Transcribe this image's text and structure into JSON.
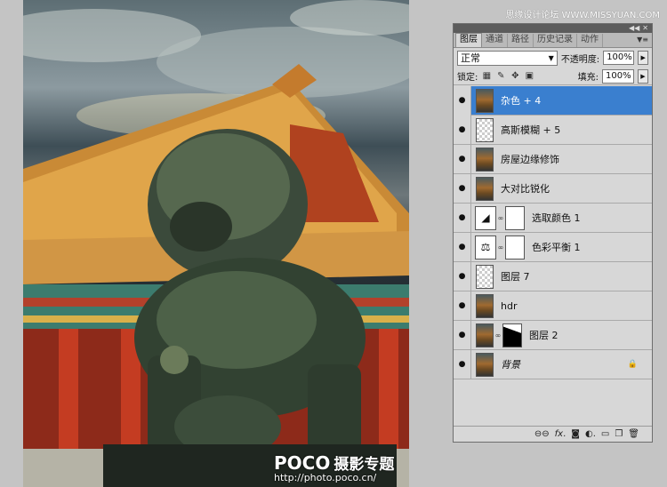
{
  "watermark": "思缘设计论坛 WWW.MISSYUAN.COM",
  "photo": {
    "brand": "POCO",
    "brand_sub": "摄影专题",
    "url": "http://photo.poco.cn/"
  },
  "panel": {
    "tabs": [
      {
        "label": "图层",
        "active": true
      },
      {
        "label": "通道",
        "active": false
      },
      {
        "label": "路径",
        "active": false
      },
      {
        "label": "历史记录",
        "active": false
      },
      {
        "label": "动作",
        "active": false
      }
    ],
    "blend_mode": "正常",
    "opacity_label": "不透明度:",
    "opacity_value": "100%",
    "lock_label": "锁定:",
    "fill_label": "填充:",
    "fill_value": "100%",
    "layers": [
      {
        "name": "杂色 + 4",
        "thumb": "photo",
        "selected": true
      },
      {
        "name": "高斯模糊 + 5",
        "thumb": "transparent",
        "selected": false
      },
      {
        "name": "房屋边缘修饰",
        "thumb": "photo",
        "selected": false
      },
      {
        "name": "大对比锐化",
        "thumb": "photo",
        "selected": false
      },
      {
        "name": "选取颜色 1",
        "thumb": "adjust-selective",
        "mask": "white",
        "selected": false
      },
      {
        "name": "色彩平衡 1",
        "thumb": "adjust-balance",
        "mask": "white",
        "selected": false
      },
      {
        "name": "图层 7",
        "thumb": "transparent",
        "selected": false
      },
      {
        "name": "hdr",
        "thumb": "photo",
        "selected": false
      },
      {
        "name": "图层 2",
        "thumb": "photo",
        "mask": "dark",
        "selected": false
      },
      {
        "name": "背景",
        "thumb": "photo",
        "selected": false,
        "locked": true,
        "italic": true
      }
    ],
    "footer_icons": [
      "link-icon",
      "fx-icon",
      "mask-icon",
      "adjustment-icon",
      "group-icon",
      "new-layer-icon",
      "trash-icon"
    ]
  }
}
